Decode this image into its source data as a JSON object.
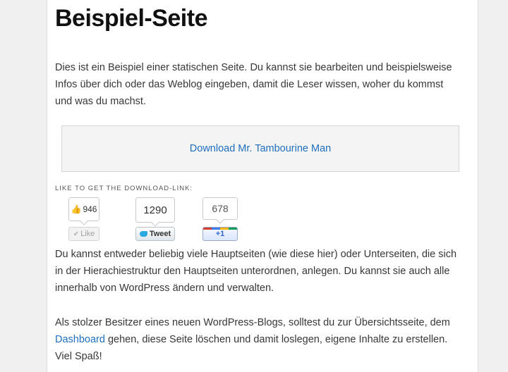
{
  "page": {
    "title": "Beispiel-Seite",
    "intro": "Dies ist ein Beispiel einer statischen Seite. Du kannst sie bearbeiten und beispielsweise Infos über dich oder das Weblog eingeben, damit die Leser wissen, woher du kommst und was du machst.",
    "download_link": "Download Mr. Tambourine Man",
    "share_label": "Like to get the download-link:",
    "para2": "Du kannst entweder beliebig viele Hauptseiten (wie diese hier) oder Unterseiten, die sich in der Hierachiestruktur den Hauptseiten unterordnen, anlegen. Du kannst sie auch alle innerhalb von WordPress ändern und verwalten.",
    "para3_before": "Als stolzer Besitzer eines neuen WordPress-Blogs, solltest du zur Übersichtsseite, dem ",
    "para3_link": "Dashboard",
    "para3_after": " gehen, diese Seite löschen und damit loslegen, eigene Inhalte zu erstellen. Viel Spaß!"
  },
  "share": {
    "facebook": {
      "count": "946",
      "label": "Like",
      "icon": "thumbs-up-icon"
    },
    "twitter": {
      "count": "1290",
      "label": "Tweet",
      "icon": "twitter-bird-icon"
    },
    "googleplus": {
      "count": "678",
      "label": "+1"
    }
  },
  "colors": {
    "link": "#1f6fbe",
    "text": "#373737",
    "download_box_bg": "#f4f4f4"
  }
}
